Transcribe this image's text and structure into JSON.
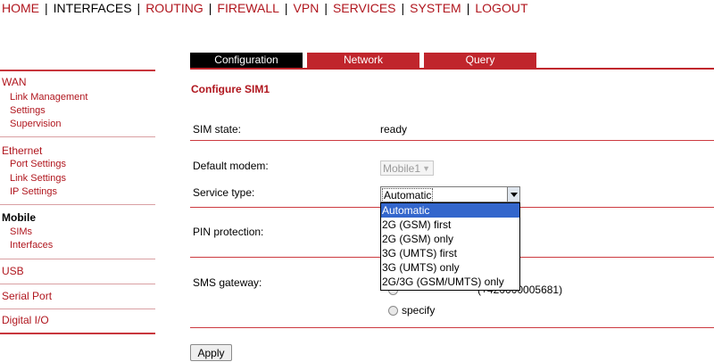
{
  "topnav": {
    "items": [
      "HOME",
      "INTERFACES",
      "ROUTING",
      "FIREWALL",
      "VPN",
      "SERVICES",
      "SYSTEM",
      "LOGOUT"
    ],
    "active": "INTERFACES",
    "separator": "|"
  },
  "sidebar": {
    "wan": {
      "title": "WAN",
      "items": [
        "Link Management",
        "Settings",
        "Supervision"
      ]
    },
    "ethernet": {
      "title": "Ethernet",
      "items": [
        "Port Settings",
        "Link Settings",
        "IP Settings"
      ]
    },
    "mobile": {
      "title": "Mobile",
      "items": [
        "SIMs",
        "Interfaces"
      ]
    },
    "usb": "USB",
    "serial_port": "Serial Port",
    "digital_io": "Digital I/O"
  },
  "tabs": [
    "Configuration",
    "Network",
    "Query"
  ],
  "page_title": "Configure SIM1",
  "form": {
    "sim_state_label": "SIM state:",
    "sim_state_value": "ready",
    "default_modem_label": "Default modem:",
    "default_modem_value": "Mobile1",
    "service_type_label": "Service type:",
    "service_type_value": "Automatic",
    "service_type_options": [
      "Automatic",
      "2G (GSM) first",
      "2G (GSM) only",
      "3G (UMTS) first",
      "3G (UMTS) only",
      "2G/3G (GSM/UMTS) only"
    ],
    "pin_protection_label": "PIN protection:",
    "sms_gateway_label": "SMS gateway:",
    "sms_gateway_partial": "(+420000005681)",
    "sms_gateway_specify": "specify"
  },
  "apply_label": "Apply",
  "colors": {
    "accent": "#b0161e",
    "tab_active": "#000000",
    "tab_inactive": "#c0252c",
    "selection": "#3366cc"
  }
}
